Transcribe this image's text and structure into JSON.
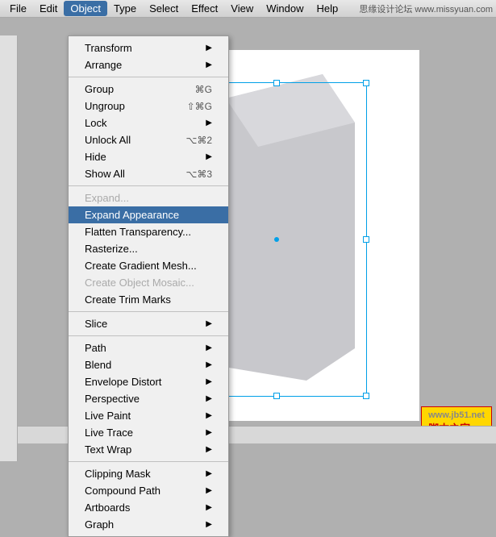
{
  "menubar": {
    "items": [
      {
        "label": "File",
        "active": false
      },
      {
        "label": "Edit",
        "active": false
      },
      {
        "label": "Object",
        "active": true
      },
      {
        "label": "Type",
        "active": false
      },
      {
        "label": "Select",
        "active": false
      },
      {
        "label": "Effect",
        "active": false
      },
      {
        "label": "View",
        "active": false
      },
      {
        "label": "Window",
        "active": false
      },
      {
        "label": "Help",
        "active": false
      }
    ],
    "watermark": "思缘设计论坛 www.missyuan.com"
  },
  "object_menu": {
    "sections": [
      {
        "items": [
          {
            "label": "Transform",
            "shortcut": "",
            "has_submenu": true,
            "disabled": false
          },
          {
            "label": "Arrange",
            "shortcut": "",
            "has_submenu": true,
            "disabled": false
          }
        ]
      },
      {
        "items": [
          {
            "label": "Group",
            "shortcut": "⌘G",
            "has_submenu": false,
            "disabled": false
          },
          {
            "label": "Ungroup",
            "shortcut": "⇧⌘G",
            "has_submenu": false,
            "disabled": false
          },
          {
            "label": "Lock",
            "shortcut": "",
            "has_submenu": true,
            "disabled": false
          },
          {
            "label": "Unlock All",
            "shortcut": "⌥⌘2",
            "has_submenu": false,
            "disabled": false
          },
          {
            "label": "Hide",
            "shortcut": "",
            "has_submenu": true,
            "disabled": false
          },
          {
            "label": "Show All",
            "shortcut": "⌥⌘3",
            "has_submenu": false,
            "disabled": false
          }
        ]
      },
      {
        "items": [
          {
            "label": "Expand...",
            "shortcut": "",
            "has_submenu": false,
            "disabled": true
          },
          {
            "label": "Expand Appearance",
            "shortcut": "",
            "has_submenu": false,
            "disabled": false,
            "active": true
          },
          {
            "label": "Flatten Transparency...",
            "shortcut": "",
            "has_submenu": false,
            "disabled": false
          },
          {
            "label": "Rasterize...",
            "shortcut": "",
            "has_submenu": false,
            "disabled": false
          },
          {
            "label": "Create Gradient Mesh...",
            "shortcut": "",
            "has_submenu": false,
            "disabled": false
          },
          {
            "label": "Create Object Mosaic...",
            "shortcut": "",
            "has_submenu": false,
            "disabled": true
          },
          {
            "label": "Create Trim Marks",
            "shortcut": "",
            "has_submenu": false,
            "disabled": false
          }
        ]
      },
      {
        "items": [
          {
            "label": "Slice",
            "shortcut": "",
            "has_submenu": true,
            "disabled": false
          }
        ]
      },
      {
        "items": [
          {
            "label": "Path",
            "shortcut": "",
            "has_submenu": true,
            "disabled": false
          },
          {
            "label": "Blend",
            "shortcut": "",
            "has_submenu": true,
            "disabled": false
          },
          {
            "label": "Envelope Distort",
            "shortcut": "",
            "has_submenu": true,
            "disabled": false
          },
          {
            "label": "Perspective",
            "shortcut": "",
            "has_submenu": true,
            "disabled": false
          },
          {
            "label": "Live Paint",
            "shortcut": "",
            "has_submenu": true,
            "disabled": false
          },
          {
            "label": "Live Trace",
            "shortcut": "",
            "has_submenu": true,
            "disabled": false
          },
          {
            "label": "Text Wrap",
            "shortcut": "",
            "has_submenu": true,
            "disabled": false
          }
        ]
      },
      {
        "items": [
          {
            "label": "Clipping Mask",
            "shortcut": "",
            "has_submenu": true,
            "disabled": false
          },
          {
            "label": "Compound Path",
            "shortcut": "",
            "has_submenu": true,
            "disabled": false
          },
          {
            "label": "Artboards",
            "shortcut": "",
            "has_submenu": true,
            "disabled": false
          },
          {
            "label": "Graph",
            "shortcut": "",
            "has_submenu": true,
            "disabled": false
          }
        ]
      }
    ]
  },
  "watermarks": {
    "top": "思缘设计论坛 www.missyuan.com",
    "bottom_site": "www.jb51.net",
    "bottom_label": "脚本之家"
  }
}
